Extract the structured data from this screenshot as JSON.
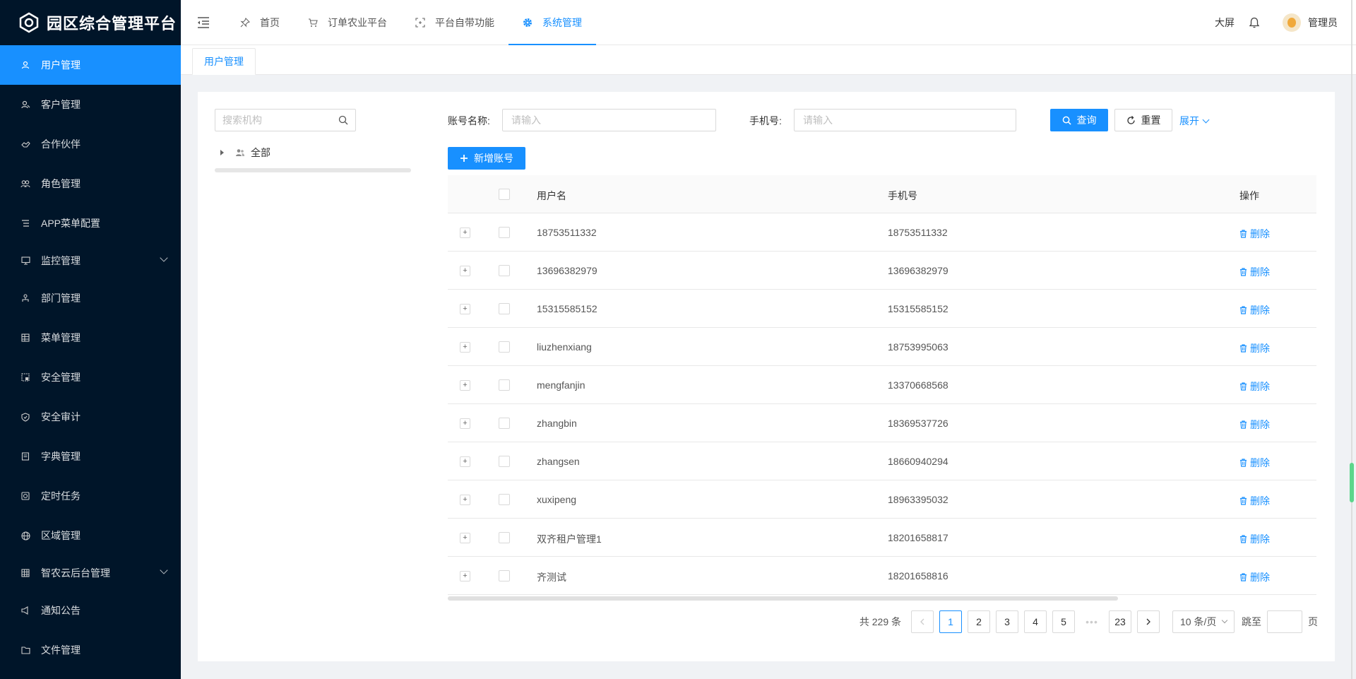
{
  "app": {
    "title": "园区综合管理平台"
  },
  "sidebar": {
    "items": [
      {
        "label": "用户管理",
        "icon": "user-icon",
        "active": true
      },
      {
        "label": "客户管理",
        "icon": "customer-icon"
      },
      {
        "label": "合作伙伴",
        "icon": "partner-icon"
      },
      {
        "label": "角色管理",
        "icon": "role-icon"
      },
      {
        "label": "APP菜单配置",
        "icon": "list-icon"
      },
      {
        "label": "监控管理",
        "icon": "monitor-icon",
        "submenu": true
      },
      {
        "label": "部门管理",
        "icon": "department-icon"
      },
      {
        "label": "菜单管理",
        "icon": "menu-grid-icon"
      },
      {
        "label": "安全管理",
        "icon": "security-icon"
      },
      {
        "label": "安全审计",
        "icon": "shield-icon"
      },
      {
        "label": "字典管理",
        "icon": "dictionary-icon"
      },
      {
        "label": "定时任务",
        "icon": "timer-icon"
      },
      {
        "label": "区域管理",
        "icon": "globe-icon"
      },
      {
        "label": "智农云后台管理",
        "icon": "grid-icon",
        "submenu": true
      },
      {
        "label": "通知公告",
        "icon": "announcement-icon"
      },
      {
        "label": "文件管理",
        "icon": "folder-icon"
      }
    ]
  },
  "header": {
    "nav": [
      {
        "label": "首页",
        "icon": "pin-icon"
      },
      {
        "label": "订单农业平台",
        "icon": "cart-icon"
      },
      {
        "label": "平台自带功能",
        "icon": "focus-icon"
      },
      {
        "label": "系统管理",
        "icon": "gear-icon",
        "active": true
      }
    ],
    "big_screen": "大屏",
    "username": "管理员"
  },
  "tabs": [
    {
      "label": "用户管理"
    }
  ],
  "tree": {
    "search_placeholder": "搜索机构",
    "root_label": "全部"
  },
  "filters": {
    "account_label": "账号名称:",
    "account_placeholder": "请输入",
    "phone_label": "手机号:",
    "phone_placeholder": "请输入",
    "query_label": "查询",
    "reset_label": "重置",
    "expand_label": "展开"
  },
  "toolbar": {
    "add_label": "新增账号"
  },
  "table": {
    "columns": {
      "username": "用户名",
      "phone": "手机号",
      "operation": "操作"
    },
    "delete_label": "删除",
    "rows": [
      {
        "username": "18753511332",
        "phone": "18753511332"
      },
      {
        "username": "13696382979",
        "phone": "13696382979"
      },
      {
        "username": "15315585152",
        "phone": "15315585152"
      },
      {
        "username": "liuzhenxiang",
        "phone": "18753995063"
      },
      {
        "username": "mengfanjin",
        "phone": "13370668568"
      },
      {
        "username": "zhangbin",
        "phone": "18369537726"
      },
      {
        "username": "zhangsen",
        "phone": "18660940294"
      },
      {
        "username": "xuxipeng",
        "phone": "18963395032"
      },
      {
        "username": "双齐租户管理1",
        "phone": "18201658817"
      },
      {
        "username": "齐测试",
        "phone": "18201658816"
      }
    ]
  },
  "pagination": {
    "total": "共 229 条",
    "pages": [
      "1",
      "2",
      "3",
      "4",
      "5"
    ],
    "ellipsis": "•••",
    "last_page": "23",
    "current": "1",
    "page_size": "10 条/页",
    "jump_label": "跳至",
    "jump_unit": "页"
  },
  "colors": {
    "primary": "#1890ff",
    "sidebar_bg": "#001529",
    "page_bg": "#f0f2f5"
  }
}
